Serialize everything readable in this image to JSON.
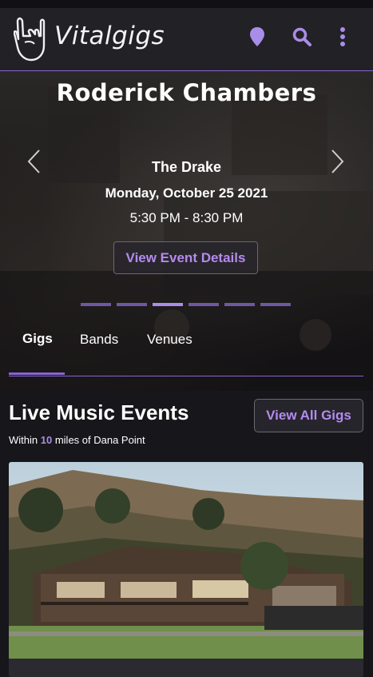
{
  "brand": {
    "name": "Vitalgigs"
  },
  "nav": {
    "icons": [
      "location-pin-icon",
      "search-icon",
      "more-vertical-icon"
    ]
  },
  "hero": {
    "title": "Roderick Chambers",
    "venue": "The Drake",
    "date": "Monday, October 25 2021",
    "time": "5:30 PM - 8:30 PM",
    "button_label": "View Event Details",
    "slide_count": 6,
    "active_slide": 3
  },
  "tabs": [
    {
      "label": "Gigs",
      "active": true
    },
    {
      "label": "Bands",
      "active": false
    },
    {
      "label": "Venues",
      "active": false
    }
  ],
  "events": {
    "title": "Live Music Events",
    "within_prefix": "Within",
    "within_miles": "10",
    "within_suffix": "miles of Dana Point",
    "view_all_label": "View All Gigs"
  },
  "colors": {
    "accent": "#8a63d2",
    "accent_text": "#b48af0",
    "background": "#17161a",
    "navbar": "#222126"
  }
}
